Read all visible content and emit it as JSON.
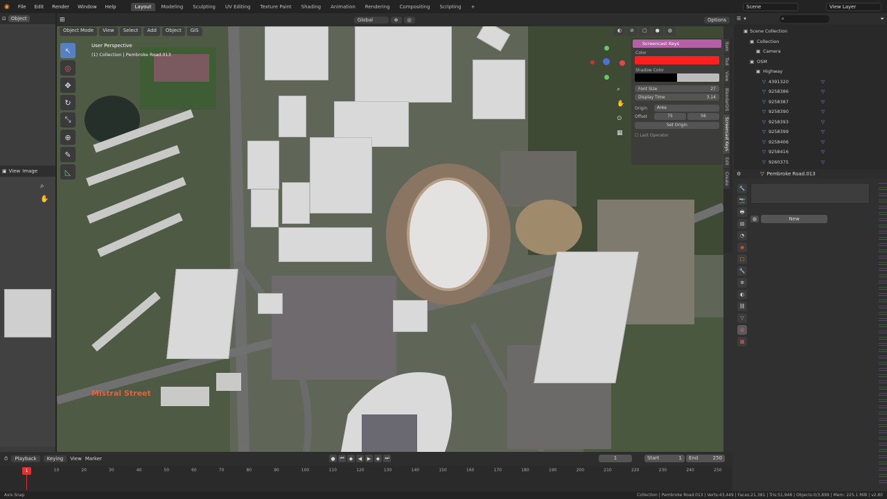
{
  "topbar": {
    "menus": [
      "File",
      "Edit",
      "Render",
      "Window",
      "Help"
    ],
    "workspaces": [
      "Layout",
      "Modeling",
      "Sculpting",
      "UV Editing",
      "Texture Paint",
      "Shading",
      "Animation",
      "Rendering",
      "Compositing",
      "Scripting"
    ],
    "active_workspace": "Layout",
    "scene": "Scene",
    "view_layer": "View Layer"
  },
  "left": {
    "mode": "Object",
    "view_label": "View",
    "image_label": "Image"
  },
  "viewport_header": {
    "transform": "Global",
    "options": "Options",
    "mode": "Object Mode",
    "menus": [
      "View",
      "Select",
      "Add",
      "Object",
      "GIS"
    ]
  },
  "viewport": {
    "perspective": "User Perspective",
    "collection": "(1) Collection | Pembroke Road.013",
    "street_label": "Mistral Street"
  },
  "npanel": {
    "title": "Screencast Keys",
    "color_label": "Color",
    "color_value": "#ff1f1f",
    "shadow_label": "Shadow Color",
    "font_size_label": "Font Size",
    "font_size_value": "27",
    "display_time_label": "Display Time",
    "display_time_value": "3.14",
    "origin_label": "Origin",
    "origin_value": "Area",
    "offset_label": "Offset",
    "offset_x": "75",
    "offset_y": "56",
    "set_origin": "Set Origin",
    "last_operator": "Last Operator",
    "tabs": [
      "Item",
      "Tool",
      "View",
      "BlenderGIS",
      "Screencast Keys",
      "Edit",
      "Create"
    ]
  },
  "outliner": {
    "scene_collection": "Scene Collection",
    "items": [
      {
        "label": "Collection",
        "indent": 1
      },
      {
        "label": "Camera",
        "indent": 2
      },
      {
        "label": "OSM",
        "indent": 1
      },
      {
        "label": "Highway",
        "indent": 2
      },
      {
        "label": "4391320",
        "indent": 3
      },
      {
        "label": "9258386",
        "indent": 3
      },
      {
        "label": "9258387",
        "indent": 3
      },
      {
        "label": "9258390",
        "indent": 3
      },
      {
        "label": "9258393",
        "indent": 3
      },
      {
        "label": "9258399",
        "indent": 3
      },
      {
        "label": "9258406",
        "indent": 3
      },
      {
        "label": "9258416",
        "indent": 3
      },
      {
        "label": "9260375",
        "indent": 3
      }
    ]
  },
  "properties": {
    "object_name": "Pembroke Road.013",
    "new_button": "New"
  },
  "timeline": {
    "playback": "Playback",
    "keying": "Keying",
    "view": "View",
    "marker": "Marker",
    "current_frame": "1",
    "start_label": "Start",
    "start_value": "1",
    "end_label": "End",
    "end_value": "250",
    "ticks": [
      "1",
      "10",
      "20",
      "30",
      "40",
      "50",
      "60",
      "70",
      "80",
      "90",
      "100",
      "110",
      "120",
      "130",
      "140",
      "150",
      "160",
      "170",
      "180",
      "190",
      "200",
      "210",
      "220",
      "230",
      "240",
      "250"
    ]
  },
  "status": {
    "left": "Axis Snap",
    "right": "Collection | Pembroke Road.013 | Verts:43,449 | Faces:21,381 | Tris:51,948 | Objects:0/3,899 | Mem: 225.1 MiB | v2.80"
  }
}
